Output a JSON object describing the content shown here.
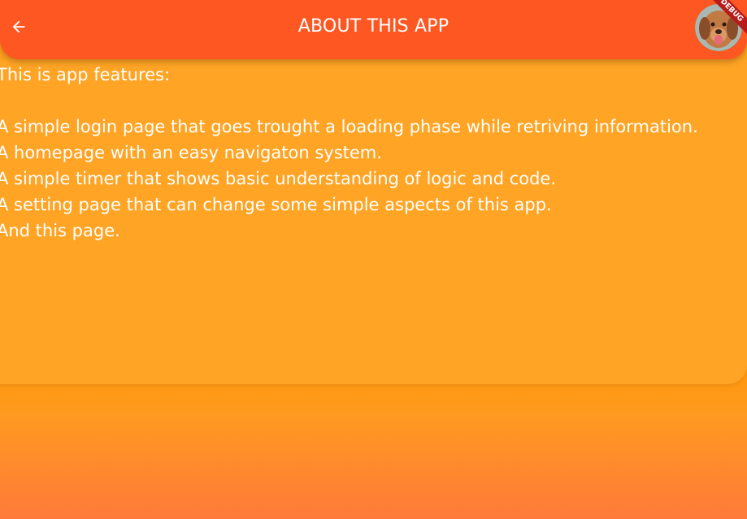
{
  "appbar": {
    "title": "ABOUT THIS APP",
    "back_icon": "arrow-back-icon",
    "avatar_alt": "dog-avatar",
    "debug_label": "DEBUG",
    "color": "#ff5722"
  },
  "content": {
    "intro": "This is app features:",
    "features": [
      "A simple login page that goes trought a loading phase while retriving information.",
      "A homepage with an easy navigaton system.",
      "A simple timer that shows basic understanding of logic and code.",
      "A setting page that can change some simple aspects of this app.",
      "And this page."
    ]
  },
  "colors": {
    "background_top": "#ffa31f",
    "background_bottom": "#ff7a3a",
    "card": "#ffa424",
    "text": "#ffffff"
  }
}
